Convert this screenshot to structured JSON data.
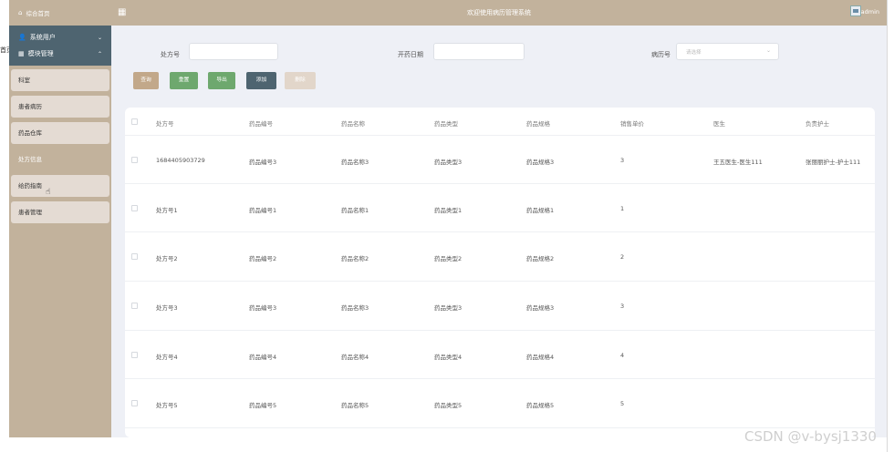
{
  "header": {
    "title": "欢迎使用病历管理系统",
    "username": "admin"
  },
  "stray_text": "首页",
  "sidebar": {
    "home_label": "综合首页",
    "groups": [
      {
        "label": "系统用户"
      },
      {
        "label": "模块管理"
      }
    ],
    "items": [
      {
        "label": "科室"
      },
      {
        "label": "患者病历"
      },
      {
        "label": "药品仓库"
      },
      {
        "label": "处方信息"
      },
      {
        "label": "给药指南"
      },
      {
        "label": "患者管理"
      }
    ]
  },
  "filters": {
    "prescription_label": "处方号",
    "prescription_value": "",
    "date_label": "开药日期",
    "date_value": "",
    "record_label": "病历号",
    "record_placeholder": "请选择"
  },
  "buttons": {
    "query": "查询",
    "reset": "重置",
    "export": "导出",
    "add": "添加",
    "delete": "删除"
  },
  "colors": {
    "brand": "#c2b29c",
    "sidebar_group": "#4e6470",
    "btn_query": "#c2a88a",
    "btn_green": "#6ea86e",
    "btn_add": "#4e6470",
    "btn_delete": "#e2d6ca"
  },
  "table": {
    "headers": [
      "处方号",
      "药品编号",
      "药品名称",
      "药品类型",
      "药品规格",
      "销售单价",
      "医生",
      "负责护士"
    ],
    "rows": [
      [
        "1684405903729",
        "药品编号3",
        "药品名称3",
        "药品类型3",
        "药品规格3",
        "3",
        "王五医生-医生111",
        "张丽丽护士-护士111"
      ],
      [
        "处方号1",
        "药品编号1",
        "药品名称1",
        "药品类型1",
        "药品规格1",
        "1",
        "",
        ""
      ],
      [
        "处方号2",
        "药品编号2",
        "药品名称2",
        "药品类型2",
        "药品规格2",
        "2",
        "",
        ""
      ],
      [
        "处方号3",
        "药品编号3",
        "药品名称3",
        "药品类型3",
        "药品规格3",
        "3",
        "",
        ""
      ],
      [
        "处方号4",
        "药品编号4",
        "药品名称4",
        "药品类型4",
        "药品规格4",
        "4",
        "",
        ""
      ],
      [
        "处方号5",
        "药品编号5",
        "药品名称5",
        "药品类型5",
        "药品规格5",
        "5",
        "",
        ""
      ]
    ]
  },
  "watermark": "CSDN @v-bysj1330"
}
